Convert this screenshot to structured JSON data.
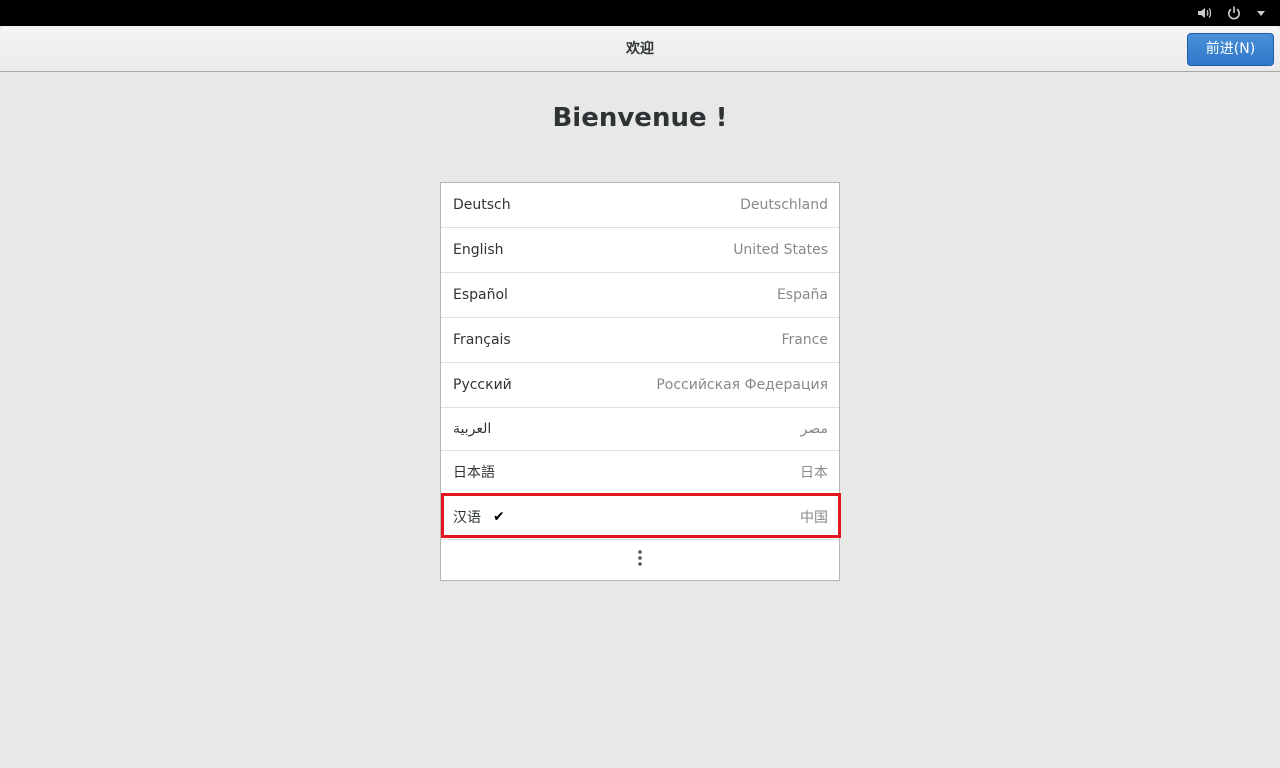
{
  "topbar": {
    "icons": [
      "volume-icon",
      "power-icon",
      "caret-down-icon"
    ]
  },
  "header": {
    "title": "欢迎",
    "next_label": "前进(N)"
  },
  "welcome_heading": "Bienvenue !",
  "languages": [
    {
      "name": "Deutsch",
      "region": "Deutschland",
      "selected": false
    },
    {
      "name": "English",
      "region": "United States",
      "selected": false
    },
    {
      "name": "Español",
      "region": "España",
      "selected": false
    },
    {
      "name": "Français",
      "region": "France",
      "selected": false
    },
    {
      "name": "Русский",
      "region": "Российская Федерация",
      "selected": false
    },
    {
      "name": "العربية",
      "region": "مصر",
      "selected": false
    },
    {
      "name": "日本語",
      "region": "日本",
      "selected": false
    },
    {
      "name": "汉语",
      "region": "中国",
      "selected": true
    }
  ],
  "check_mark": "✔",
  "more_icon": "vertical-ellipsis-icon",
  "colors": {
    "accent": "#3584e4",
    "highlight": "#e3161f"
  }
}
